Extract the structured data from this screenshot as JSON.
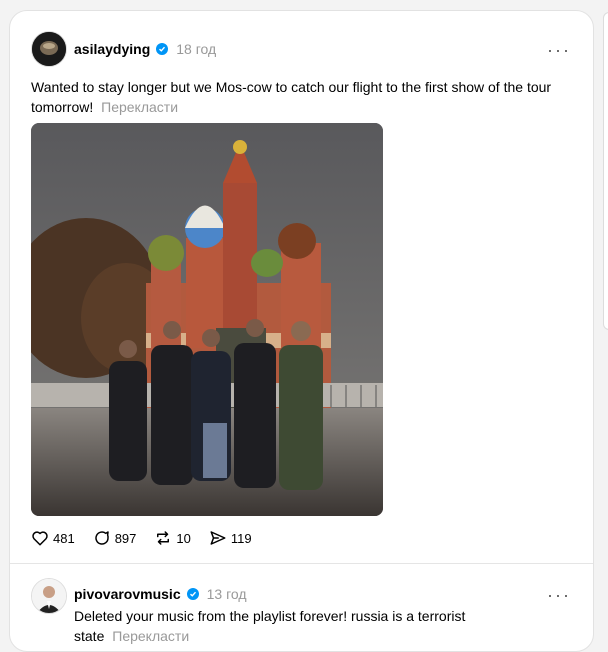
{
  "posts": [
    {
      "username": "asilaydying",
      "time": "18 год",
      "text": "Wanted to stay longer but we Mos-cow to catch our flight to the first show of the tour tomorrow!",
      "translate_label": "Перекласти",
      "stats": {
        "likes": "481",
        "comments": "897",
        "reposts": "10",
        "shares": "119"
      }
    },
    {
      "username": "pivovarovmusic",
      "time": "13 год",
      "text": "Deleted your music from the playlist forever! russia is a terrorist state",
      "translate_label": "Перекласти"
    }
  ],
  "icons": {
    "more": "more-icon",
    "like": "heart-icon",
    "comment": "comment-icon",
    "repost": "repost-icon",
    "share": "share-icon",
    "verified": "verified-badge-icon"
  },
  "colors": {
    "verified": "#0095f6",
    "meta_gray": "#999999"
  }
}
